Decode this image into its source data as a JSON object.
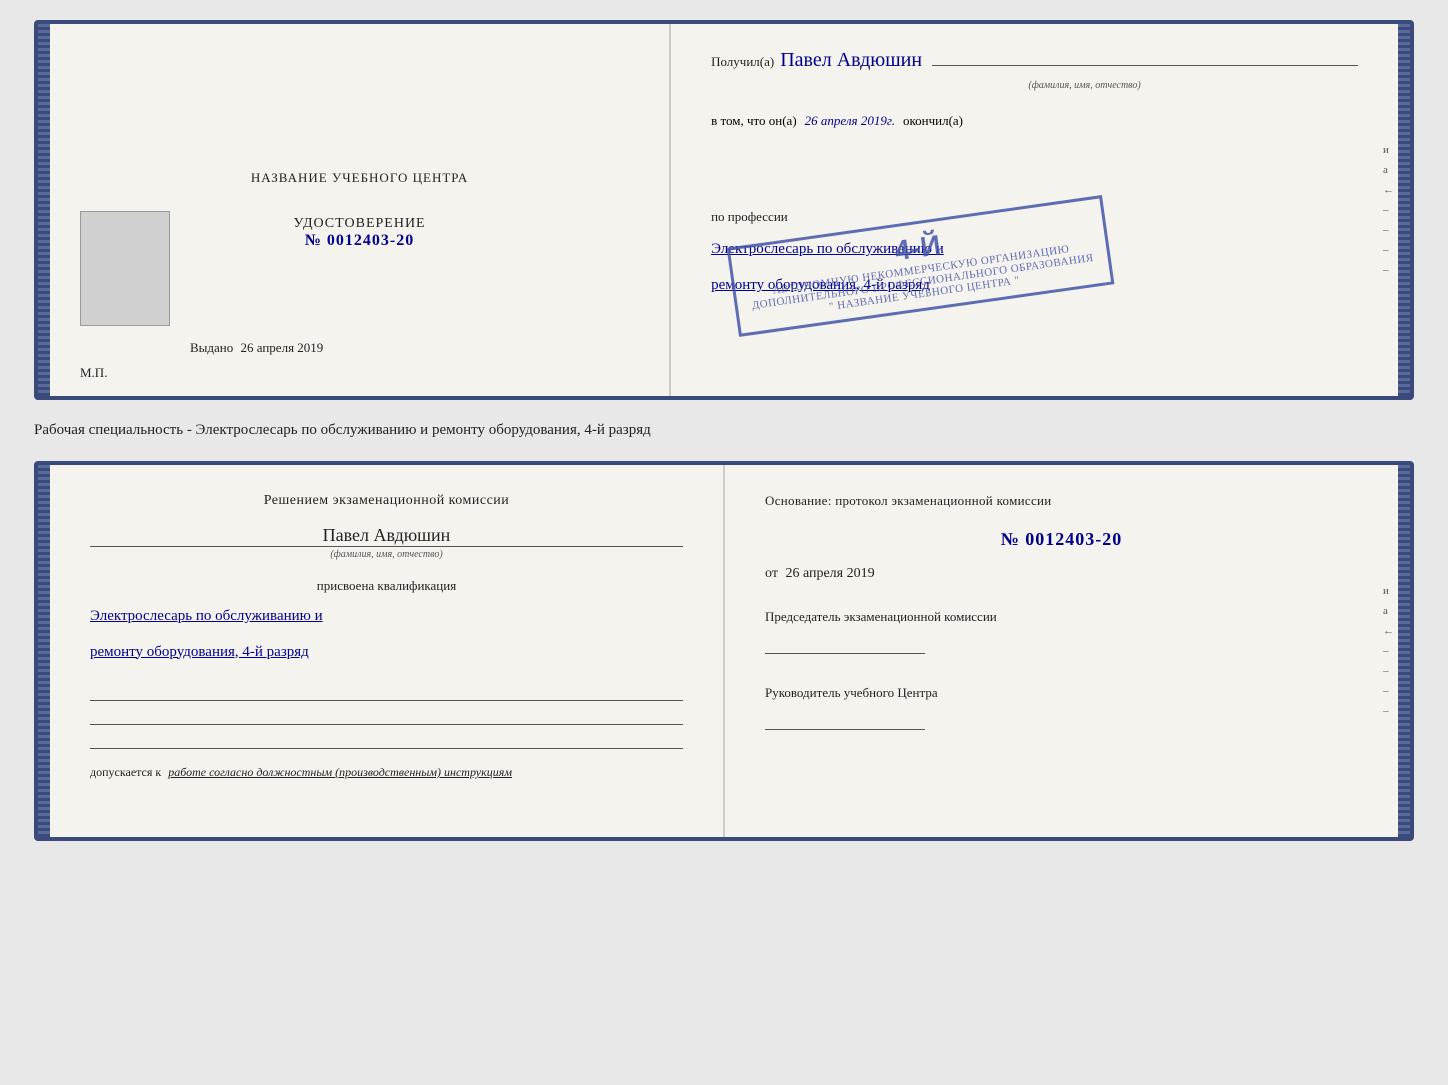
{
  "top_cert": {
    "left": {
      "title": "НАЗВАНИЕ УЧЕБНОГО ЦЕНТРА",
      "udostoverenie_label": "УДОСТОВЕРЕНИЕ",
      "number": "№ 0012403-20",
      "vydano_prefix": "Выдано",
      "vydano_date": "26 апреля 2019",
      "mp_label": "М.П."
    },
    "right": {
      "recipient_prefix": "Получил(a)",
      "recipient_name": "Павел Авдюшин",
      "fio_label": "(фамилия, имя, отчество)",
      "vtom_prefix": "в том, что он(a)",
      "vtom_date": "26 апреля 2019г.",
      "okonchill": "окончил(а)",
      "stamp_line1": "АВТОНОМНУЮ НЕКОММЕРЧЕСКУЮ ОРГАНИЗАЦИЮ",
      "stamp_line2": "ДОПОЛНИТЕЛЬНОГО ПРОФЕССИОНАЛЬНОГО ОБРАЗОВАНИЯ",
      "stamp_line3": "\" НАЗВАНИЕ УЧЕБНОГО ЦЕНТРА \"",
      "stamp_num": "4-й",
      "po_professii": "по профессии",
      "profession": "Электрослесарь по обслуживанию и",
      "profession2": "ремонту оборудования, 4-й разряд"
    }
  },
  "separator": {
    "text": "Рабочая специальность - Электрослесарь по обслуживанию и ремонту оборудования, 4-й разряд"
  },
  "bottom_cert": {
    "left": {
      "decision_title": "Решением экзаменационной комиссии",
      "person_name": "Павел Авдюшин",
      "fio_label": "(фамилия, имя, отчество)",
      "prisvoena": "присвоена квалификация",
      "profession": "Электрослесарь по обслуживанию и",
      "profession2": "ремонту оборудования, 4-й разряд",
      "dopuskaetsya_prefix": "допускается к",
      "dopuskaetsya_text": "работе согласно должностным (производственным) инструкциям"
    },
    "right": {
      "osnov_title": "Основание: протокол экзаменационной комиссии",
      "osnov_number": "№ 0012403-20",
      "ot_prefix": "от",
      "ot_date": "26 апреля 2019",
      "predsedatel_title": "Председатель экзаменационной комиссии",
      "rukovoditel_title": "Руководитель учебного Центра"
    }
  },
  "side_marks": [
    "и",
    "а",
    "←",
    "–",
    "–",
    "–",
    "–"
  ],
  "side_marks2": [
    "и",
    "а",
    "←",
    "–",
    "–",
    "–",
    "–"
  ]
}
